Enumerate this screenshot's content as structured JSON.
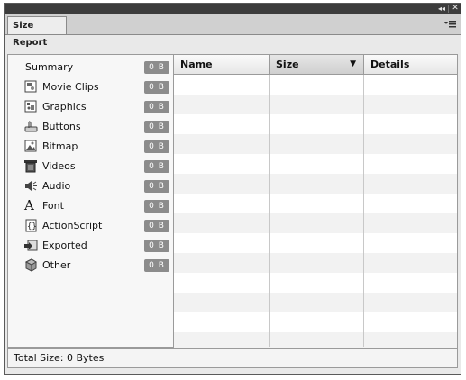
{
  "panel": {
    "tab_title": "Size Report",
    "collapse_icon": "double-chevron-right-icon",
    "close_icon": "close-icon",
    "menu_icon": "panel-menu-icon"
  },
  "categories": [
    {
      "label": "Summary",
      "size": "0 B",
      "icon": ""
    },
    {
      "label": "Movie Clips",
      "size": "0 B",
      "icon": "movie-clip-icon"
    },
    {
      "label": "Graphics",
      "size": "0 B",
      "icon": "graphic-icon"
    },
    {
      "label": "Buttons",
      "size": "0 B",
      "icon": "button-icon"
    },
    {
      "label": "Bitmap",
      "size": "0 B",
      "icon": "bitmap-icon"
    },
    {
      "label": "Videos",
      "size": "0 B",
      "icon": "video-icon"
    },
    {
      "label": "Audio",
      "size": "0 B",
      "icon": "audio-icon"
    },
    {
      "label": "Font",
      "size": "0 B",
      "icon": "font-icon"
    },
    {
      "label": "ActionScript",
      "size": "0 B",
      "icon": "actionscript-icon"
    },
    {
      "label": "Exported",
      "size": "0 B",
      "icon": "exported-icon"
    },
    {
      "label": "Other",
      "size": "0 B",
      "icon": "other-icon"
    }
  ],
  "table": {
    "columns": [
      {
        "label": "Name",
        "sorted": false
      },
      {
        "label": "Size",
        "sorted": true,
        "sort_direction": "descending"
      },
      {
        "label": "Details",
        "sorted": false
      }
    ],
    "rows": []
  },
  "footer": {
    "total_label": "Total Size: 0 Bytes"
  },
  "colors": {
    "badge": "#8c8c8c",
    "titlebar": "#3c3c3c"
  }
}
